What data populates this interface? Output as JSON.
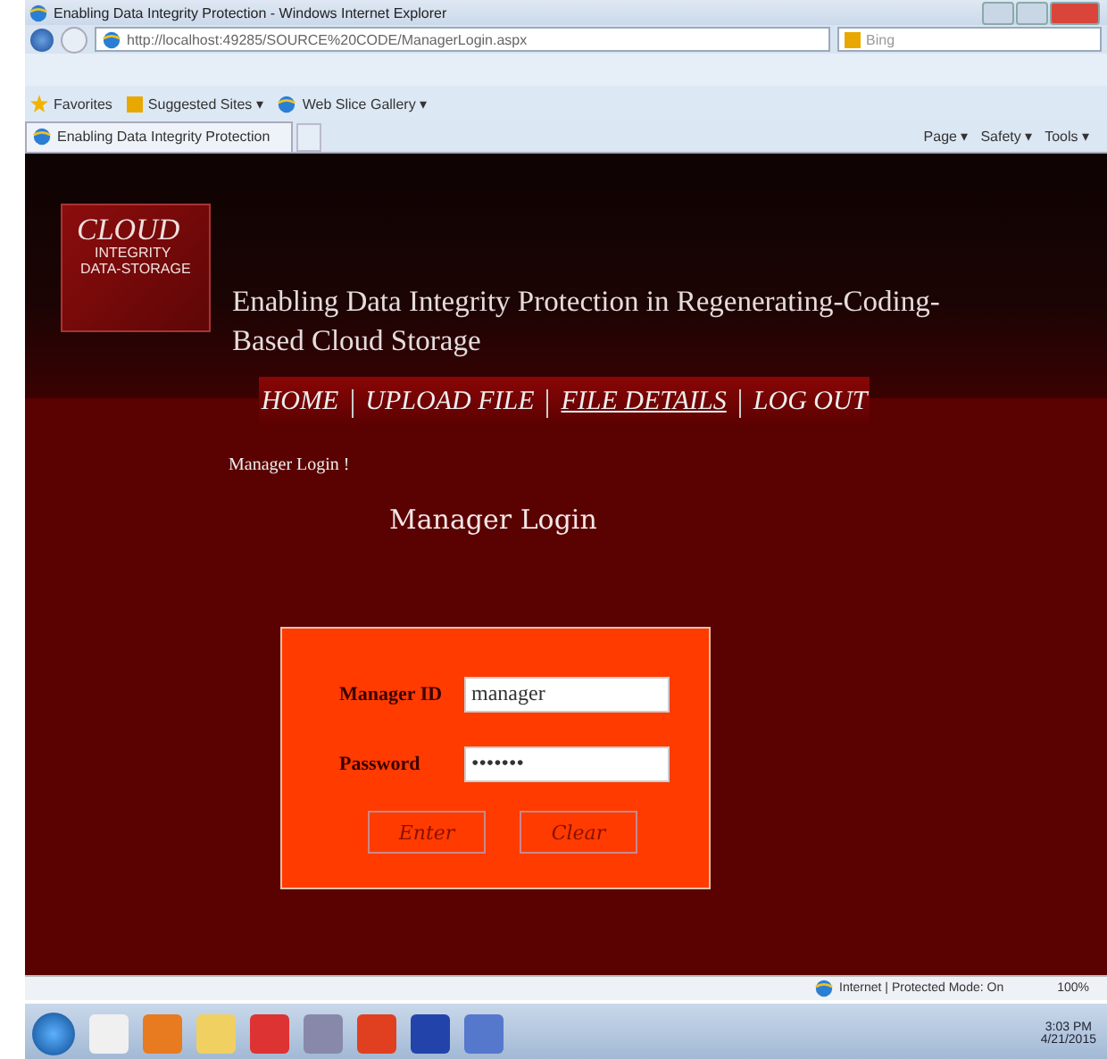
{
  "window": {
    "title": "Enabling Data Integrity Protection - Windows Internet Explorer"
  },
  "address_bar": {
    "url": "http://localhost:49285/SOURCE%20CODE/ManagerLogin.aspx",
    "search_placeholder": "Bing"
  },
  "favorites_bar": {
    "items": [
      {
        "label": "Favorites",
        "kind": "star"
      },
      {
        "label": "Suggested Sites ▾",
        "kind": "bing"
      },
      {
        "label": "Web Slice Gallery ▾",
        "kind": "ie"
      }
    ]
  },
  "tab": {
    "label": "Enabling Data Integrity Protection"
  },
  "command_bar": [
    "Page ▾",
    "Safety ▾",
    "Tools ▾"
  ],
  "page": {
    "logo": {
      "line_1": "CLOUD",
      "line_2": "INTEGRITY",
      "line_3": "DATA-STORAGE"
    },
    "title": "Enabling Data Integrity Protection in Regenerating-Coding-Based Cloud Storage",
    "nav": [
      {
        "label": "HOME",
        "selected": false
      },
      {
        "label": "UPLOAD FILE",
        "selected": false
      },
      {
        "label": "FILE DETAILS",
        "selected": true
      },
      {
        "label": "LOG OUT",
        "selected": false
      }
    ],
    "breadcrumb": "Manager Login !",
    "heading": "Manager Login",
    "form": {
      "fields": [
        {
          "label": "Manager ID",
          "value": "manager"
        },
        {
          "label": "Password",
          "value": "•••••••"
        }
      ],
      "buttons": [
        "Enter",
        "Clear"
      ]
    }
  },
  "status_bar": {
    "zone": "Internet | Protected Mode: On",
    "zoom": "100%"
  },
  "taskbar": {
    "time": "3:03 PM",
    "date": "4/21/2015"
  }
}
